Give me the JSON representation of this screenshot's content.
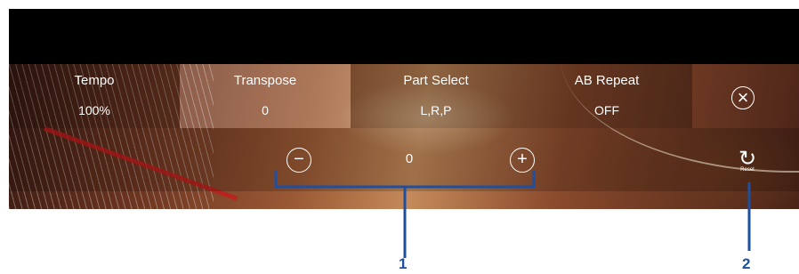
{
  "tabs": [
    {
      "label": "Tempo",
      "value": "100%"
    },
    {
      "label": "Transpose",
      "value": "0"
    },
    {
      "label": "Part Select",
      "value": "L,R,P"
    },
    {
      "label": "AB Repeat",
      "value": "OFF"
    }
  ],
  "close_icon": "×",
  "transpose": {
    "minus_icon": "−",
    "value": "0",
    "plus_icon": "+"
  },
  "reset": {
    "icon": "↻",
    "label": "Reset"
  },
  "callouts": {
    "one": "1",
    "two": "2"
  },
  "colors": {
    "callout": "#1e4fa0",
    "accent_red": "#c41a1a"
  }
}
